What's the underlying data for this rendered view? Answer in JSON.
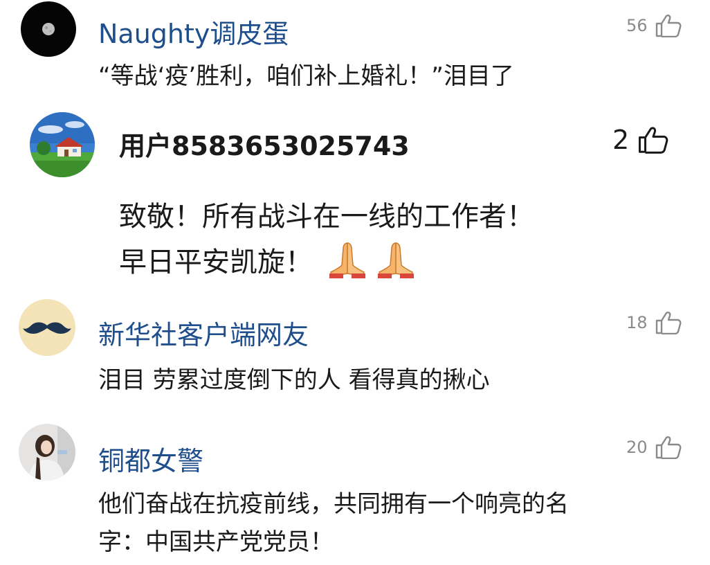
{
  "comments": [
    {
      "username": "Naughty调皮蛋",
      "likes": "56",
      "text": "“等战‘疫’胜利，咱们补上婚礼！”泪目了",
      "avatar_icon": "moon-night-avatar"
    },
    {
      "username": "用户8583653025743",
      "likes": "2",
      "text_line1": "致敬！所有战斗在一线的工作者！",
      "text_line2": "早日平安凯旋！",
      "emoji": "folded-hands",
      "avatar_icon": "house-landscape-avatar"
    },
    {
      "username": "新华社客户端网友",
      "likes": "18",
      "text": "泪目 劳累过度倒下的人 看得真的揪心",
      "avatar_icon": "mustache-avatar"
    },
    {
      "username": "铜都女警",
      "likes": "20",
      "text_line1": "他们奋战在抗疫前线，共同拥有一个响亮的名",
      "text_line2": "字：中国共产党党员！",
      "avatar_icon": "woman-photo-avatar"
    }
  ],
  "colors": {
    "username_blue": "#1f4e8c",
    "like_gray": "#8a8a8a",
    "text_dark": "#1a1a1a"
  }
}
